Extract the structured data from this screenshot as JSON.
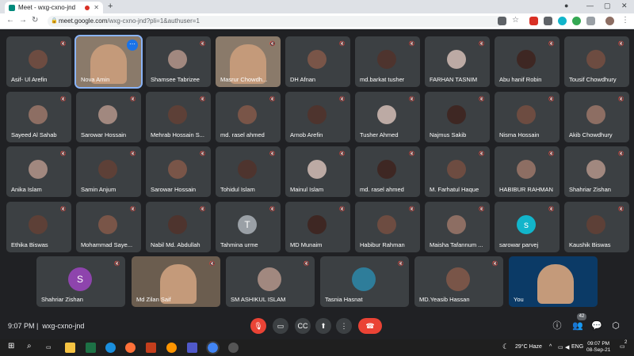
{
  "browser": {
    "tab_title": "Meet - wxg-cxno-jnd",
    "url_host": "meet.google.com",
    "url_path": "/wxg-cxno-jnd?pli=1&authuser=1"
  },
  "meeting": {
    "time": "9:07 PM",
    "code": "wxg-cxno-jnd",
    "participant_count": "42"
  },
  "participants_rows": [
    [
      "Asif- Ul Arefin",
      "Nova Amin",
      "Shamsee Tabrizee",
      "Masrur Chowdh...",
      "DH Afnan",
      "md.barkat tusher",
      "FARHAN TASNIM",
      "Abu hanif Robin",
      "Tousif Chowdhury"
    ],
    [
      "Sayeed Al Sahab",
      "Sarowar Hossain",
      "Mehrab Hossain S...",
      "md. rasel ahmed",
      "Arnob Arefin",
      "Tusher Ahmed",
      "Najmus Sakib",
      "Nisma Hossain",
      "Akib Chowdhury"
    ],
    [
      "Anika Islam",
      "Samin Anjum",
      "Sarowar Hossain",
      "Tohidul Islam",
      "Mainul Islam",
      "md. rasel ahmed",
      "M. Farhatul Haque",
      "HABIBUR RAHMAN",
      "Shahriar Zishan"
    ],
    [
      "Ethika Biswas",
      "Mohammad Saye...",
      "Nabil Md. Abdullah",
      "Tahmina urme",
      "MD Munaim",
      "Habibur Rahman",
      "Maisha Tafannum ...",
      "sarowar parvej",
      "Kaushik Biswas"
    ]
  ],
  "row5": [
    "Shahriar Zishan",
    "Md Zilan Saif",
    "SM ASHIKUL ISLAM",
    "Tasnia Hasnat",
    "MD.Yeasib Hassan",
    "You"
  ],
  "letters": {
    "tahmina": "T",
    "sarowar": "s",
    "shahriar": "S"
  },
  "taskbar": {
    "weather": "29°C Haze",
    "lang": "ENG",
    "clock_time": "09:07 PM",
    "clock_date": "08-Sep-21",
    "notif_count": "2"
  }
}
